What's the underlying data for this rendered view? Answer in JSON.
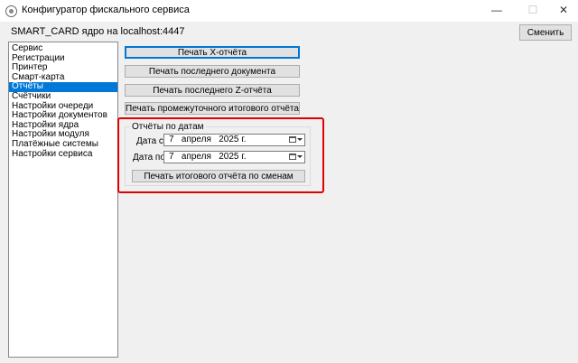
{
  "window": {
    "title": "Конфигуратор фискального сервиса",
    "minimize": "—",
    "maximize": "☐",
    "close": "✕"
  },
  "header": {
    "core_label": "SMART_CARD ядро на localhost:4447",
    "change_button": "Сменить"
  },
  "sidebar": {
    "selected_index": 4,
    "items": [
      {
        "label": "Сервис"
      },
      {
        "label": "Регистрации"
      },
      {
        "label": "Принтер"
      },
      {
        "label": "Смарт-карта"
      },
      {
        "label": "Отчёты"
      },
      {
        "label": "Счётчики"
      },
      {
        "label": "Настройки очереди"
      },
      {
        "label": "Настройки документов"
      },
      {
        "label": "Настройки ядра"
      },
      {
        "label": "Настройки модуля"
      },
      {
        "label": "Платёжные системы"
      },
      {
        "label": "Настройки сервиса"
      }
    ]
  },
  "reports": {
    "print_x": "Печать X-отчёта",
    "print_last_doc": "Печать последнего документа",
    "print_last_z": "Печать последнего Z-отчёта",
    "print_interim": "Печать промежуточного итогового отчёта",
    "by_dates": {
      "title": "Отчёты по датам",
      "from_label": "Дата с:",
      "from_value": "7   апреля   2025 г.",
      "to_label": "Дата по:",
      "to_value": "7   апреля   2025 г.",
      "print_shifts": "Печать итогового отчёта по сменам"
    }
  },
  "colors": {
    "selection": "#0078d7",
    "highlight_border": "#e00000"
  }
}
